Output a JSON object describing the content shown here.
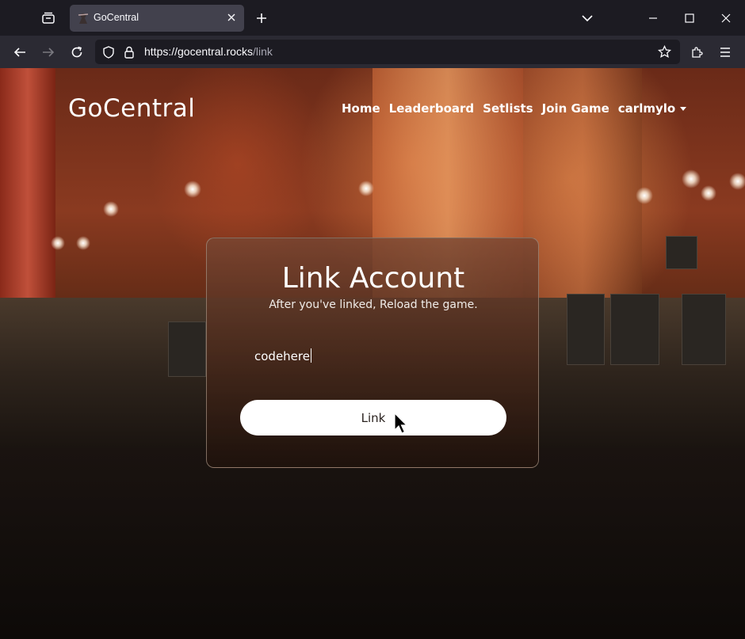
{
  "browser": {
    "tab_title": "GoCentral",
    "url_host": "https://gocentral.rocks",
    "url_path": "/link"
  },
  "site": {
    "brand": "GoCentral",
    "nav": [
      {
        "label": "Home"
      },
      {
        "label": "Leaderboard"
      },
      {
        "label": "Setlists"
      },
      {
        "label": "Join Game"
      },
      {
        "label": "carlmylo"
      }
    ]
  },
  "link_card": {
    "heading": "Link Account",
    "subtitle": "After you've linked, Reload the game.",
    "code_value": "codehere",
    "button_label": "Link"
  },
  "colors": {
    "chrome_dark": "#1c1b22",
    "chrome_toolbar": "#2b2a33",
    "tab_active": "#42414d",
    "button_bg": "#ffffff"
  }
}
